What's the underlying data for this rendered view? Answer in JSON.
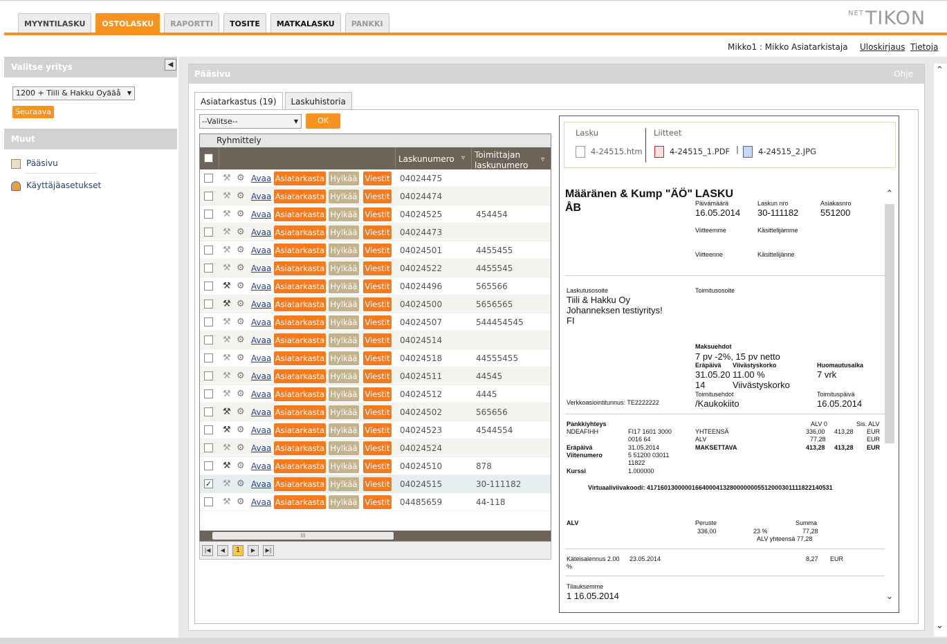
{
  "tabs": [
    {
      "label": "MYYNTILASKU",
      "state": "normal"
    },
    {
      "label": "OSTOLASKU",
      "state": "active"
    },
    {
      "label": "RAPORTTI",
      "state": "dim"
    },
    {
      "label": "TOSITE",
      "state": "dark"
    },
    {
      "label": "MATKALASKU",
      "state": "dark"
    },
    {
      "label": "PANKKI",
      "state": "dim"
    }
  ],
  "logo": {
    "prefix": "NET",
    "text": "TIKON"
  },
  "userbar": {
    "user": "Mikko1 : Mikko Asiatarkistaja",
    "logout": "Uloskirjaus",
    "info": "Tietoja"
  },
  "sidebar": {
    "company_header": "Valitse yritys",
    "company_selected": "1200 + Tiili & Hakku Oyääå",
    "next_button": "Seuraava",
    "other_header": "Muut",
    "links": [
      "Pääsivu",
      "Käyttäjäasetukset"
    ]
  },
  "panel": {
    "title": "Pääsivu",
    "help": "Ohje"
  },
  "subtabs": [
    "Asiatarkastus (19)",
    "Laskuhistoria"
  ],
  "filter": {
    "selected": "--Valitse--",
    "ok": "OK"
  },
  "grid": {
    "grouping_label": "Ryhmittely",
    "col_invoice": "Laskunumero",
    "col_supplier_invoice": "Toimittajan laskunumero",
    "open_label": "Avaa",
    "btn_check": "Asiatarkasta",
    "btn_reject": "Hylkää",
    "btn_message": "Viestit",
    "rows": [
      {
        "num": "04024475",
        "tnum": "",
        "hammer": false,
        "checked": false
      },
      {
        "num": "04024474",
        "tnum": "",
        "hammer": false,
        "checked": false
      },
      {
        "num": "04024525",
        "tnum": "454454",
        "hammer": false,
        "checked": false
      },
      {
        "num": "04024473",
        "tnum": "",
        "hammer": false,
        "checked": false
      },
      {
        "num": "04024501",
        "tnum": "4455455",
        "hammer": false,
        "checked": false
      },
      {
        "num": "04024522",
        "tnum": "4455545",
        "hammer": false,
        "checked": false
      },
      {
        "num": "04024496",
        "tnum": "565566",
        "hammer": true,
        "checked": false
      },
      {
        "num": "04024500",
        "tnum": "5656565",
        "hammer": true,
        "checked": false
      },
      {
        "num": "04024507",
        "tnum": "544454545",
        "hammer": false,
        "checked": false
      },
      {
        "num": "04024514",
        "tnum": "",
        "hammer": false,
        "checked": false
      },
      {
        "num": "04024518",
        "tnum": "44555455",
        "hammer": false,
        "checked": false
      },
      {
        "num": "04024511",
        "tnum": "44545",
        "hammer": false,
        "checked": false
      },
      {
        "num": "04024512",
        "tnum": "4445",
        "hammer": false,
        "checked": false
      },
      {
        "num": "04024502",
        "tnum": "565656",
        "hammer": true,
        "checked": false
      },
      {
        "num": "04024523",
        "tnum": "4544554",
        "hammer": true,
        "checked": false
      },
      {
        "num": "04024524",
        "tnum": "",
        "hammer": false,
        "checked": false
      },
      {
        "num": "04024510",
        "tnum": "878",
        "hammer": true,
        "checked": false
      },
      {
        "num": "04024515",
        "tnum": "30-111182",
        "hammer": false,
        "checked": true
      },
      {
        "num": "04485659",
        "tnum": "44-118",
        "hammer": false,
        "checked": false
      }
    ],
    "scroll_thumb": "III",
    "current_page": "1"
  },
  "attachments": {
    "invoice_header": "Lasku",
    "attachments_header": "Liitteet",
    "invoice_file": "4-24515.htm",
    "files": [
      "4-24515_1.PDF",
      "4-24515_2.JPG"
    ],
    "separator": "|"
  },
  "invoice": {
    "supplier_line1": "Määränen & Kump \"ÄÖ\"",
    "supplier_line2": "ÅB",
    "title": "LASKU",
    "date_label": "Päivämäärä",
    "date": "16.05.2014",
    "invno_label": "Laskun nro",
    "invno": "30-111182",
    "custno_label": "Asiakasnro",
    "custno": "551200",
    "our_ref": "Viitteemme",
    "our_handler": "Käsittelijämme",
    "your_ref": "Viitteenne",
    "your_handler": "Käsittelijänne",
    "billing_label": "Laskutusosoite",
    "billing_lines": [
      "Tiili & Hakku Oy",
      "Johanneksen testiyritys!",
      "FI"
    ],
    "delivery_label": "Toimitusosoite",
    "terms_label": "Maksuehdot",
    "terms": "7 pv -2%, 15 pv netto",
    "due_label": "Eräpäivä",
    "due": "31.05.20",
    "due2": "14",
    "interest_label": "Viivästyskorko",
    "interest": "11.00 %",
    "interest2": "Viivästyskorko",
    "notice_label": "Huomautusaika",
    "notice": "7 vrk",
    "einvoice": "Verkkoasiointitunnus: TE2222222",
    "delivery_terms_label": "Toimitusehdot",
    "delivery_terms": "/Kaukokiito",
    "delivery_date_label": "Toimituspäivä",
    "delivery_date": "16.05.2014",
    "bank_label": "Pankkiyhteys",
    "bank_bic": "NDEAFIHH",
    "iban1": "FI17 1601 3000",
    "iban2": "0016 64",
    "due_label2": "Eräpäivä",
    "due_full": "31.05.2014",
    "ref_label": "Viitenumero",
    "ref1": "5 51200 03011",
    "ref2": "11822",
    "rate_label": "Kurssi",
    "rate": "1.000000",
    "alv0_label": "ALV 0",
    "sis_alv_label": "Sis. ALV",
    "total_label": "YHTEENSÄ",
    "total_alv0": "336,00",
    "total_sis": "413,28",
    "cur1": "EUR",
    "alv_label": "ALV",
    "alv_amount": "77,28",
    "cur2": "EUR",
    "payable_label": "MAKSETTAVA",
    "payable_alv0": "413,28",
    "payable_sis": "413,28",
    "cur3": "EUR",
    "virtual_barcode": "Virtuaaliviivakoodi: 417160130000016640004132800000005512000301111822140531",
    "vat_header": "ALV",
    "base_label": "Peruste",
    "sum_label": "Summa",
    "base": "336,00",
    "vat_rate": "23 %",
    "vat_sum": "77,28",
    "vat_total": "ALV yhteensä 77,28",
    "cash_discount": "Käteisalennus 2.00",
    "cash_discount_pct": "%",
    "cash_discount_date": "23.05.2014",
    "cash_discount_amount": "8,27",
    "cash_discount_cur": "EUR",
    "order_label": "Tilauksemme",
    "order": "1 16.05.2014"
  },
  "colors": {
    "accent": "#f7931e",
    "grid_header": "#6e6357",
    "reject": "#c2b28e"
  }
}
